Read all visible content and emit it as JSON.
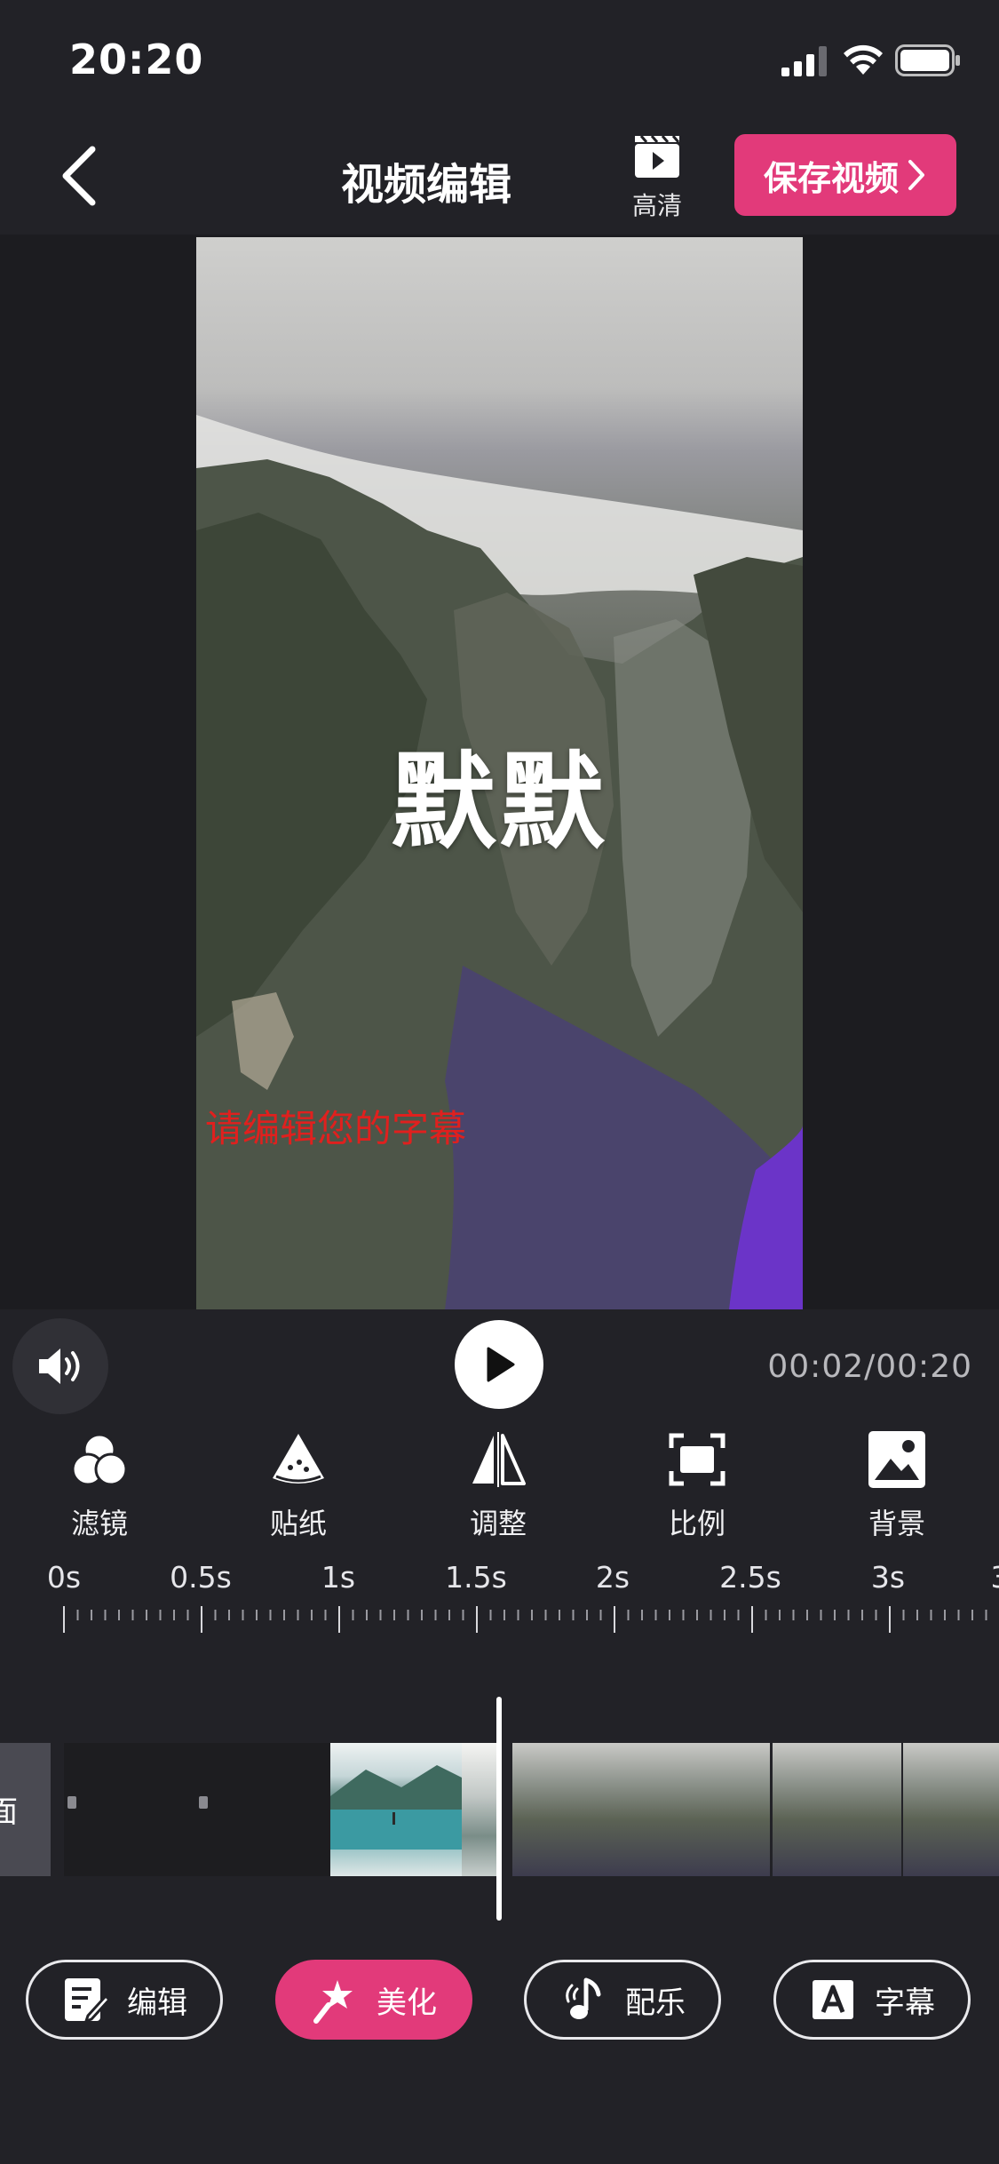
{
  "status_bar": {
    "time": "20:20",
    "icons": [
      "signal-icon",
      "wifi-icon",
      "battery-icon"
    ]
  },
  "header": {
    "title": "视频编辑",
    "back_icon": "chevron-left-icon",
    "hd_label": "高清",
    "save_label": "保存视频",
    "accent_color": "#e23a7a"
  },
  "preview": {
    "overlay_title": "默默",
    "overlay_subtitle": "请编辑您的字幕",
    "subtitle_color": "#e0201e"
  },
  "controls": {
    "volume_icon": "speaker-icon",
    "play_icon": "play-icon",
    "time": "00:02/00:20"
  },
  "tools": [
    {
      "label": "滤镜",
      "icon": "filter-icon"
    },
    {
      "label": "贴纸",
      "icon": "sticker-icon"
    },
    {
      "label": "调整",
      "icon": "adjust-icon"
    },
    {
      "label": "比例",
      "icon": "ratio-icon"
    },
    {
      "label": "背景",
      "icon": "background-icon"
    }
  ],
  "ruler": {
    "ticks": [
      "0s",
      "0.5s",
      "1s",
      "1.5s",
      "2s",
      "2.5s",
      "3s",
      "3"
    ]
  },
  "timeline": {
    "cover_label": "面"
  },
  "bottom_tabs": [
    {
      "label": "编辑",
      "icon": "edit-icon",
      "active": false
    },
    {
      "label": "美化",
      "icon": "magic-wand-icon",
      "active": true
    },
    {
      "label": "配乐",
      "icon": "music-icon",
      "active": false
    },
    {
      "label": "字幕",
      "icon": "subtitle-icon",
      "active": false
    }
  ]
}
